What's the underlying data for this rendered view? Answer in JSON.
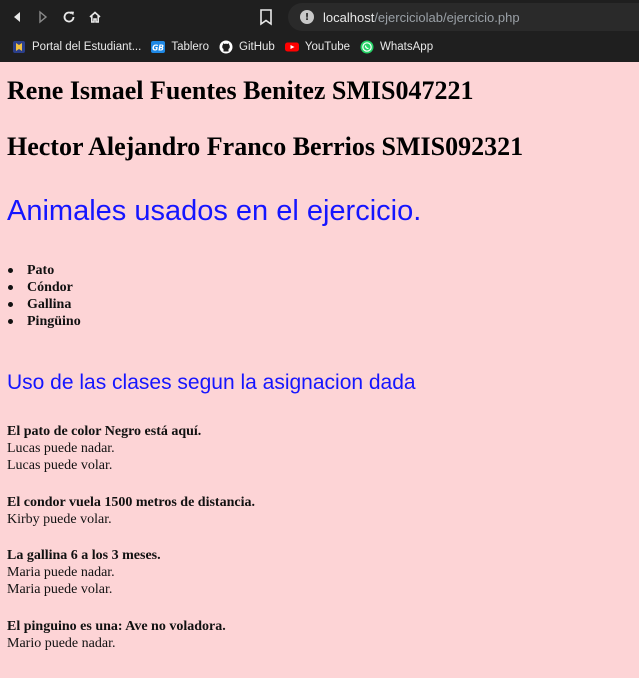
{
  "browser": {
    "url_host": "localhost",
    "url_path": "/ejerciciolab/ejercicio.php",
    "bookmarks": [
      {
        "label": "Portal del Estudiant...",
        "icon": "portal-icon"
      },
      {
        "label": "Tablero",
        "icon": "gb-icon",
        "icon_text": "GB"
      },
      {
        "label": "GitHub",
        "icon": "github-icon"
      },
      {
        "label": "YouTube",
        "icon": "youtube-icon"
      },
      {
        "label": "WhatsApp",
        "icon": "whatsapp-icon"
      }
    ]
  },
  "page": {
    "authors": [
      "Rene Ismael Fuentes Benitez SMIS047221",
      "Hector Alejandro Franco Berrios SMIS092321"
    ],
    "heading_animals": "Animales usados en el ejercicio.",
    "animals": [
      "Pato",
      "Cóndor",
      "Gallina",
      "Pingüino"
    ],
    "heading_classes": "Uso de las clases segun la asignacion dada",
    "blocks": [
      {
        "title": "El pato de color Negro está aquí.",
        "lines": [
          "Lucas puede nadar.",
          "Lucas puede volar."
        ]
      },
      {
        "title": "El condor vuela 1500 metros de distancia.",
        "lines": [
          "Kirby puede volar."
        ]
      },
      {
        "title": "La gallina 6 a los 3 meses.",
        "lines": [
          "Maria puede nadar.",
          "Maria puede volar."
        ]
      },
      {
        "title": "El pinguino es una: Ave no voladora.",
        "lines": [
          "Mario puede nadar."
        ]
      }
    ]
  },
  "colors": {
    "page_background": "#fdd4d6",
    "heading_blue": "#1515ff",
    "chrome_background": "#1f1f1f"
  }
}
